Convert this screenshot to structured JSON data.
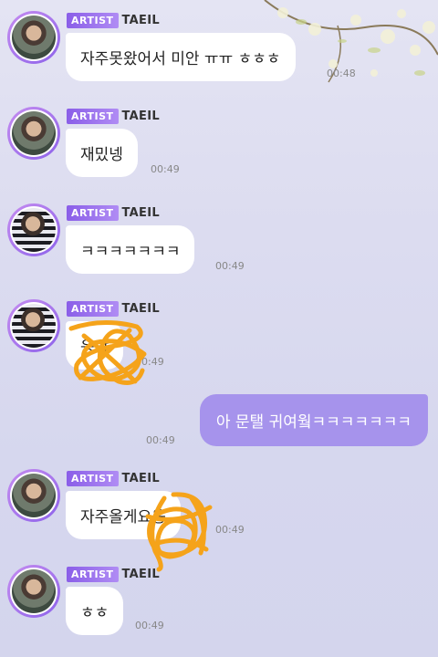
{
  "conversation": {
    "artist_badge": "ARTIST",
    "artist_name": "TAEIL",
    "messages": [
      {
        "text": "자주못왔어서 미안 ㅠㅠ ㅎㅎㅎ",
        "time": "00:48"
      },
      {
        "text": "재밌넹",
        "time": "00:49"
      },
      {
        "text": "ㅋㅋㅋㅋㅋㅋㅋ",
        "time": "00:49"
      },
      {
        "text": "응앙",
        "time": "00:49"
      },
      {
        "text": "아 문탤 귀여웤ㅋㅋㅋㅋㅋㅋㅋ",
        "time": "00:49"
      },
      {
        "text": "자주올게요응",
        "time": "00:49"
      },
      {
        "text": "ㅎㅎ",
        "time": "00:49"
      }
    ]
  },
  "colors": {
    "accent": "#a693ec",
    "badge": "#8a5ee8",
    "scribble": "#f5a31a"
  }
}
